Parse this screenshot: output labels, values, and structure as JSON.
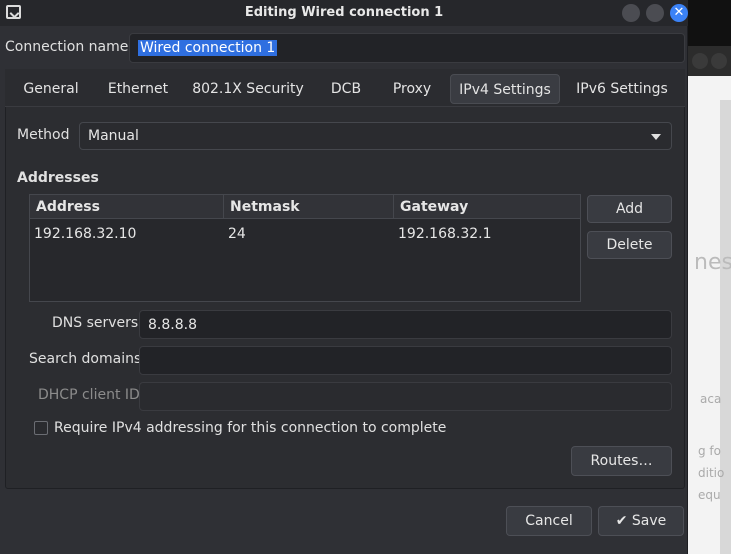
{
  "window": {
    "title": "Editing Wired connection 1"
  },
  "connection_name": {
    "label": "Connection name",
    "value": "Wired connection 1"
  },
  "tabs": [
    {
      "label": "General"
    },
    {
      "label": "Ethernet"
    },
    {
      "label": "802.1X Security"
    },
    {
      "label": "DCB"
    },
    {
      "label": "Proxy"
    },
    {
      "label": "IPv4 Settings"
    },
    {
      "label": "IPv6 Settings"
    }
  ],
  "active_tab": "IPv4 Settings",
  "method": {
    "label": "Method",
    "value": "Manual"
  },
  "addresses": {
    "heading": "Addresses",
    "columns": [
      "Address",
      "Netmask",
      "Gateway"
    ],
    "rows": [
      [
        "192.168.32.10",
        "24",
        "192.168.32.1"
      ]
    ],
    "add_label": "Add",
    "delete_label": "Delete"
  },
  "dns": {
    "label": "DNS servers",
    "value": "8.8.8.8"
  },
  "search_domains": {
    "label": "Search domains",
    "value": ""
  },
  "dhcp_client_id": {
    "label": "DHCP client ID",
    "value": ""
  },
  "require_ipv4": {
    "label": "Require IPv4 addressing for this connection to complete",
    "checked": false
  },
  "routes_label": "Routes…",
  "footer": {
    "cancel_label": "Cancel",
    "save_label": "Save"
  },
  "background_window": {
    "fragment_large": "nes",
    "fragment_lines": [
      "g fo",
      "ditio",
      "equ"
    ],
    "fragment_mid": "aca"
  },
  "colors": {
    "accent": "#3b82f6",
    "selection": "#2f6fe0",
    "dialog_bg": "#2f3035"
  }
}
